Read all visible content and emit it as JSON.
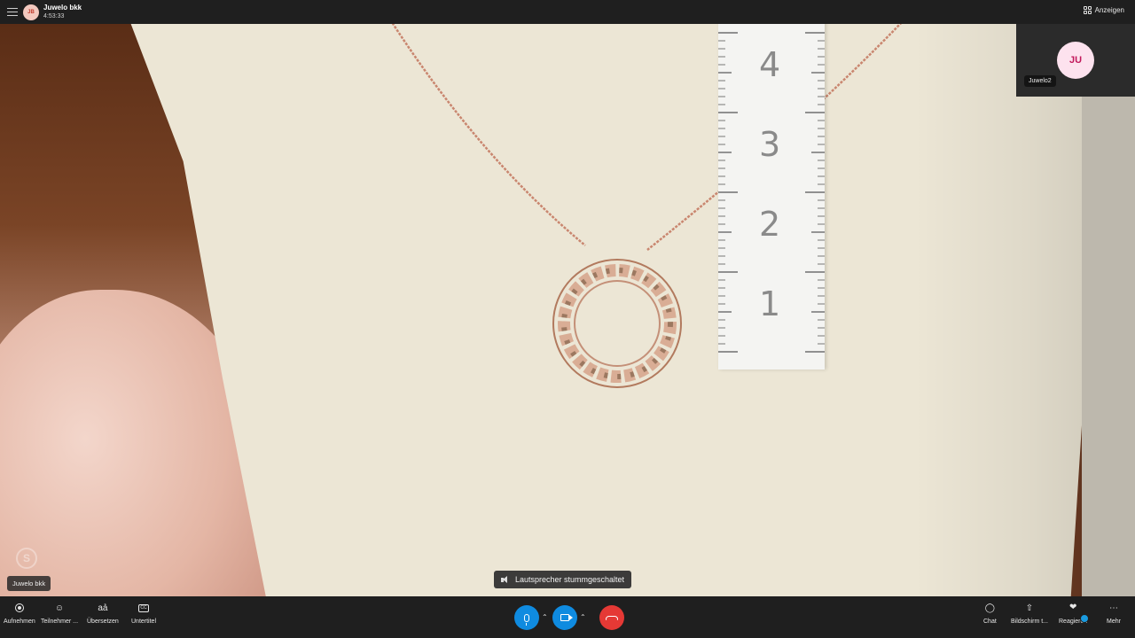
{
  "header": {
    "avatar_initials": "JB",
    "title": "Juwelo bkk",
    "duration": "4:53:33",
    "view_label": "Anzeigen"
  },
  "video": {
    "ruler_numbers": [
      "4",
      "3",
      "2",
      "1"
    ],
    "speaker_name": "Juwelo bkk",
    "notification": "Lautsprecher stummgeschaltet"
  },
  "selfview": {
    "initials": "JU",
    "name": "Juwelo2"
  },
  "toolbar": {
    "left": [
      {
        "label": "Aufnehmen",
        "icon": "record-icon"
      },
      {
        "label": "Teilnehmer ...",
        "icon": "participants-icon"
      },
      {
        "label": "Übersetzen",
        "icon": "translate-icon"
      },
      {
        "label": "Untertitel",
        "icon": "subtitles-icon"
      }
    ],
    "right": [
      {
        "label": "Chat",
        "icon": "chat-icon"
      },
      {
        "label": "Bildschirm t...",
        "icon": "share-screen-icon"
      },
      {
        "label": "Reagieren",
        "icon": "heart-icon"
      },
      {
        "label": "Mehr",
        "icon": "more-icon"
      }
    ],
    "colors": {
      "mic": "#0f8be0",
      "camera": "#0f8be0",
      "hangup": "#e53935"
    }
  }
}
